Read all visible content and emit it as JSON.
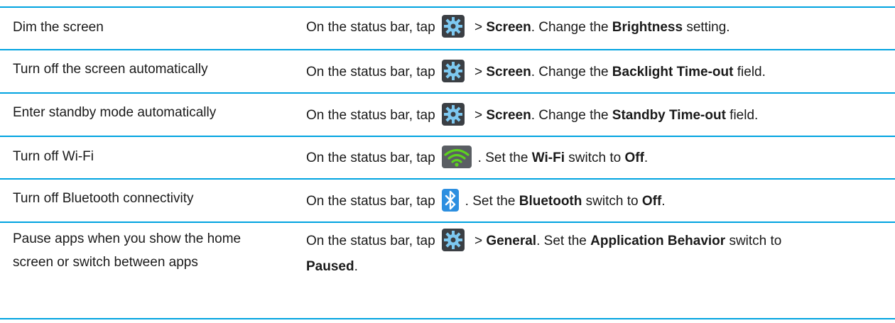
{
  "rows": [
    {
      "task": "Dim the screen",
      "prefix": "On the status bar, tap",
      "icon": "gear-icon",
      "after_icon": " > ",
      "bold1": "Screen",
      "mid": ". Change the ",
      "bold2": "Brightness",
      "end": " setting."
    },
    {
      "task": "Turn off the screen automatically",
      "prefix": "On the status bar, tap",
      "icon": "gear-icon",
      "after_icon": " > ",
      "bold1": "Screen",
      "mid": ". Change the ",
      "bold2": "Backlight Time-out",
      "end": " field."
    },
    {
      "task": "Enter standby mode automatically",
      "prefix": "On the status bar, tap",
      "icon": "gear-icon",
      "after_icon": " > ",
      "bold1": "Screen",
      "mid": ". Change the ",
      "bold2": "Standby Time-out",
      "end": " field."
    },
    {
      "task": "Turn off Wi-Fi",
      "prefix": "On the status bar, tap",
      "icon": "wifi-icon",
      "after_icon": ". Set the ",
      "bold1": "Wi-Fi",
      "mid": " switch to ",
      "bold2": "Off",
      "end": "."
    },
    {
      "task": "Turn off Bluetooth connectivity",
      "prefix": "On the status bar, tap",
      "icon": "bluetooth-icon",
      "after_icon": ". Set the ",
      "bold1": "Bluetooth",
      "mid": " switch to ",
      "bold2": "Off",
      "end": "."
    },
    {
      "task_line1": "Pause apps when you show the home",
      "task_line2": "screen or switch between apps",
      "prefix": "On the status bar, tap",
      "icon": "gear-icon",
      "after_icon": " > ",
      "bold1": "General",
      "mid": ". Set the ",
      "bold2": "Application Behavior",
      "end_line1": " switch to",
      "bold3": "Paused",
      "end": "."
    }
  ],
  "colors": {
    "divider": "#00a3e0",
    "gear_bg": "#3b3f44",
    "wifi_green": "#5dd21f",
    "bluetooth_bg": "#2d8fe0"
  }
}
